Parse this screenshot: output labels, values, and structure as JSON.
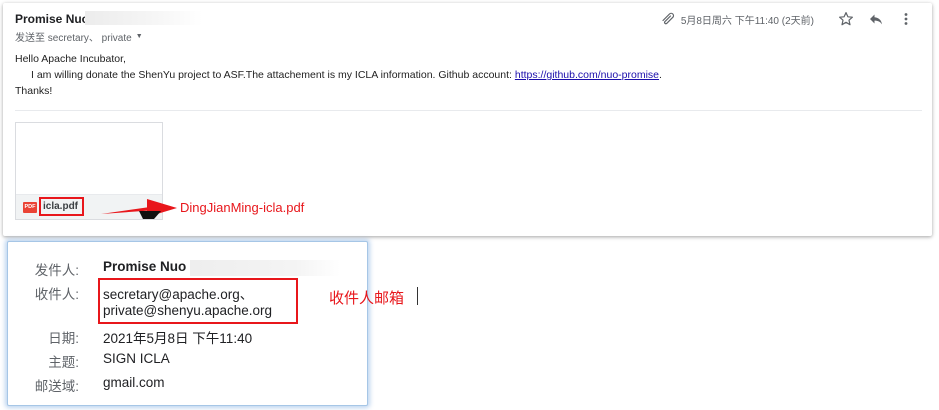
{
  "email": {
    "sender_name": "Promise Nuo",
    "recipients_line": "发送至 secretary、 private",
    "date": "5月8日周六 下午11:40 (2天前)",
    "body": {
      "greeting": "Hello Apache Incubator,",
      "line_prefix": "I am willing donate the ShenYu project to ASF.The attachement is my ICLA information. Github account: ",
      "github_link": "https://github.com/nuo-promise",
      "line_suffix": ".",
      "closing": "Thanks!"
    },
    "attachment": {
      "badge": "PDF",
      "filename": "icla.pdf"
    }
  },
  "annotations": {
    "rename_note": "DingJianMing-icla.pdf",
    "recipient_note": "收件人邮箱"
  },
  "details": {
    "from_label": "发件人:",
    "from_value": "Promise Nuo",
    "to_label": "收件人:",
    "to_line1": "secretary@apache.org、",
    "to_line2": "private@shenyu.apache.org",
    "date_label": "日期:",
    "date_value": "2021年5月8日 下午11:40",
    "subject_label": "主题:",
    "subject_value": "SIGN ICLA",
    "mailed_by_label": "邮送域:",
    "mailed_by_value": "gmail.com"
  },
  "colors": {
    "annotation_red": "#e8161b",
    "link_blue": "#1a0dab",
    "popup_border": "#a6c6e6"
  },
  "icons": [
    "paperclip-icon",
    "star-icon",
    "reply-icon",
    "more-vert-icon",
    "pdf-icon",
    "arrow-icon"
  ]
}
